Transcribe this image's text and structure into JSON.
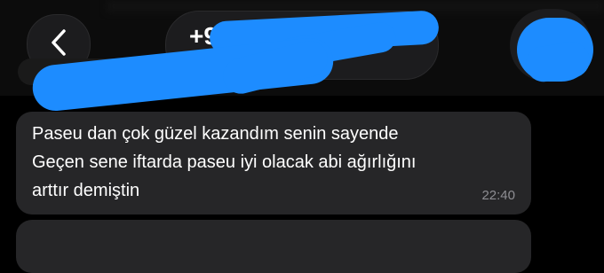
{
  "header": {
    "contact_name": "+9",
    "back_icon": "chevron-left-icon"
  },
  "message": {
    "lines": [
      "Paseu dan çok güzel kazandım senin sayende",
      "Geçen sene iftarda paseu iyi olacak abi ağırlığını",
      "arttır demiştin"
    ],
    "time": "22:40"
  },
  "colors": {
    "background": "#000000",
    "bubble": "#262628",
    "redaction": "#1d8cff",
    "text": "#ffffff",
    "timestamp": "#8e8e93"
  }
}
